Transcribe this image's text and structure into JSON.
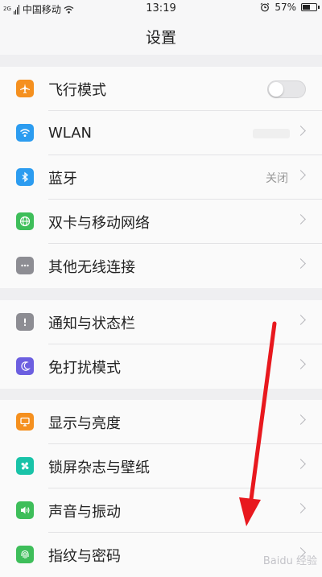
{
  "status_bar": {
    "signal_type": "2G",
    "carrier": "中国移动",
    "time": "13:19",
    "battery": "57%",
    "battery_level": 0.57,
    "icons": [
      "signal-icon",
      "wifi-icon",
      "alarm-icon",
      "battery-icon"
    ]
  },
  "header": {
    "title": "设置"
  },
  "groups": [
    {
      "items": [
        {
          "label": "飞行模式",
          "icon": "airplane-icon",
          "color": "#f5901f",
          "control": "toggle",
          "toggle_on": false
        },
        {
          "label": "WLAN",
          "icon": "wifi-icon",
          "color": "#2c9cf0",
          "control": "chevron",
          "value": ""
        },
        {
          "label": "蓝牙",
          "icon": "bluetooth-icon",
          "color": "#2c9cf0",
          "control": "chevron",
          "value": "关闭"
        },
        {
          "label": "双卡与移动网络",
          "icon": "globe-icon",
          "color": "#3ebe5a",
          "control": "chevron"
        },
        {
          "label": "其他无线连接",
          "icon": "more-icon",
          "color": "#8d8d93",
          "control": "chevron"
        }
      ]
    },
    {
      "items": [
        {
          "label": "通知与状态栏",
          "icon": "exclamation-icon",
          "color": "#8d8d93",
          "control": "chevron"
        },
        {
          "label": "免打扰模式",
          "icon": "moon-icon",
          "color": "#6c5fe0",
          "control": "chevron"
        }
      ]
    },
    {
      "items": [
        {
          "label": "显示与亮度",
          "icon": "display-icon",
          "color": "#f5901f",
          "control": "chevron"
        },
        {
          "label": "锁屏杂志与壁纸",
          "icon": "pinwheel-icon",
          "color": "#19c3a8",
          "control": "chevron"
        },
        {
          "label": "声音与振动",
          "icon": "speaker-icon",
          "color": "#3ebe5a",
          "control": "chevron"
        },
        {
          "label": "指纹与密码",
          "icon": "fingerprint-icon",
          "color": "#3ebe5a",
          "control": "chevron"
        }
      ]
    }
  ],
  "annotation": {
    "arrow_color": "#e8181e"
  },
  "watermark": "Baidu 经验"
}
